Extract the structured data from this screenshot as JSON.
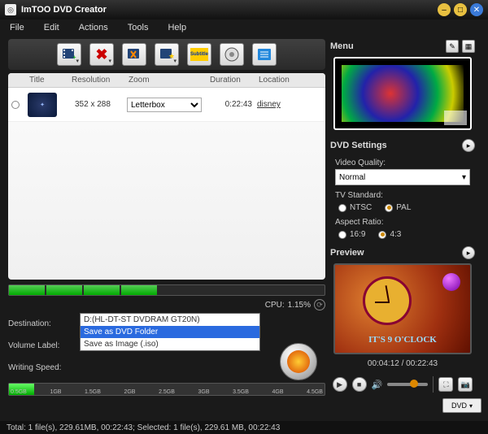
{
  "titlebar": {
    "title": "ImTOO DVD Creator"
  },
  "menubar": [
    "File",
    "Edit",
    "Actions",
    "Tools",
    "Help"
  ],
  "list": {
    "headers": {
      "title": "Title",
      "resolution": "Resolution",
      "zoom": "Zoom",
      "duration": "Duration",
      "location": "Location"
    },
    "rows": [
      {
        "resolution": "352 x 288",
        "zoom": "Letterbox",
        "duration": "0:22:43",
        "location": "disney"
      }
    ]
  },
  "cpu": {
    "label": "CPU:",
    "value": "1.15%"
  },
  "form": {
    "destination_label": "Destination:",
    "destination_value": "D:(HL-DT-ST DVDRAM GT20N)",
    "volume_label": "Volume Label:",
    "writing_label": "Writing Speed:",
    "dropdown_options": [
      "D:(HL-DT-ST DVDRAM GT20N)",
      "Save as DVD Folder",
      "Save as Image (.iso)"
    ]
  },
  "capacity_ticks": [
    "0.5GB",
    "1GB",
    "1.5GB",
    "2GB",
    "2.5GB",
    "3GB",
    "3.5GB",
    "4GB",
    "4.5GB"
  ],
  "dvd_chip": "DVD",
  "right": {
    "menu_title": "Menu",
    "settings_title": "DVD Settings",
    "video_quality_label": "Video Quality:",
    "video_quality_value": "Normal",
    "tv_standard_label": "TV Standard:",
    "tv_ntsc": "NTSC",
    "tv_pal": "PAL",
    "aspect_label": "Aspect Ratio:",
    "aspect_169": "16:9",
    "aspect_43": "4:3",
    "preview_title": "Preview",
    "clock_text": "IT'S 9 O'CLOCK",
    "time_elapsed": "00:04:12",
    "time_total": "00:22:43"
  },
  "statusbar": "Total: 1 file(s), 229.61MB, 00:22:43; Selected: 1 file(s), 229.61 MB,  00:22:43"
}
